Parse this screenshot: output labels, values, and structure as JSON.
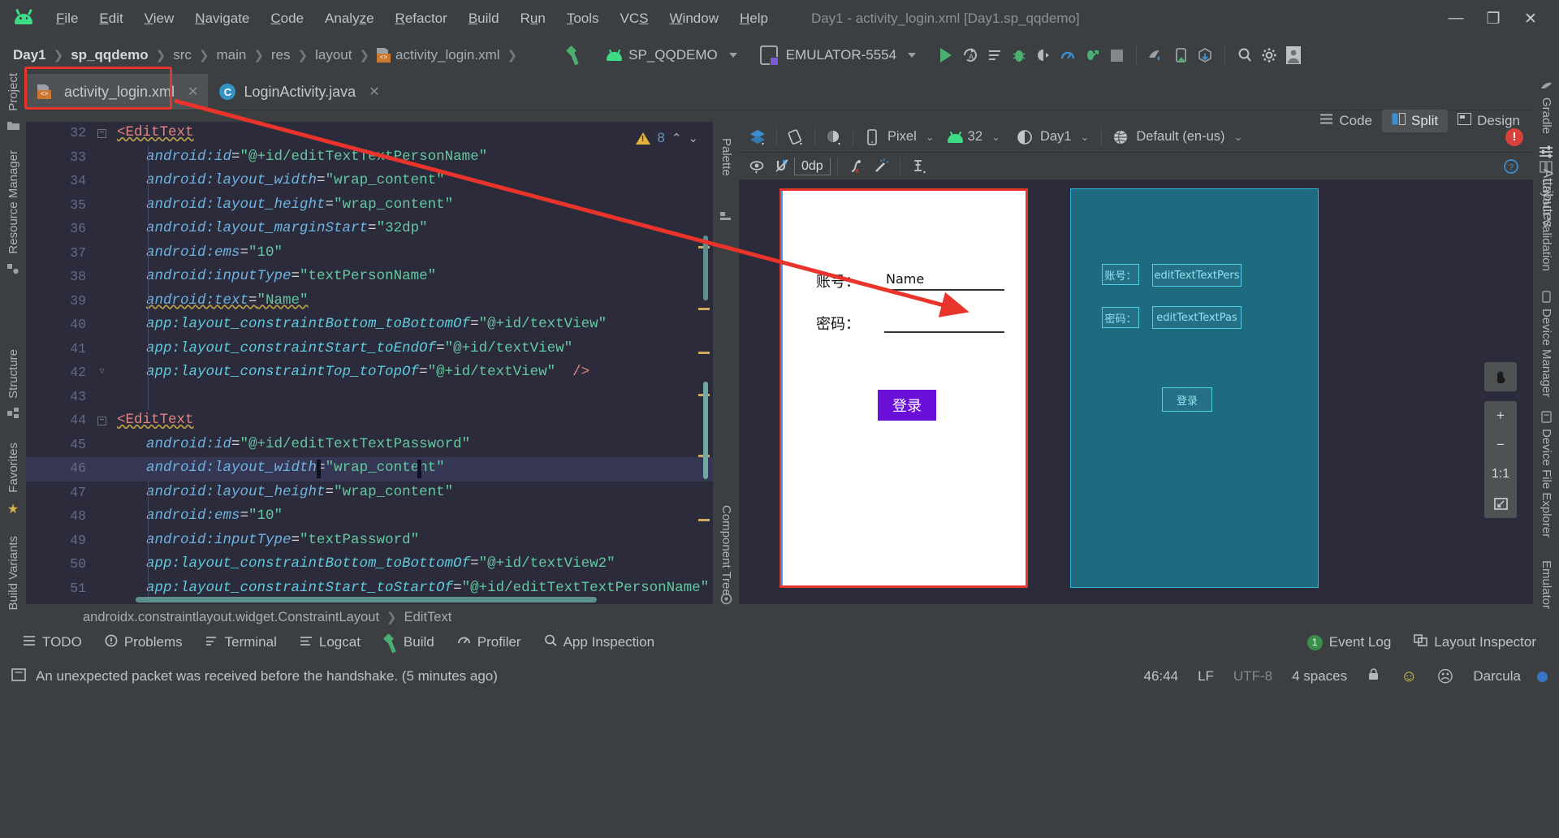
{
  "window": {
    "title": "Day1 - activity_login.xml [Day1.sp_qqdemo]",
    "minimize": "—",
    "maximize": "❐",
    "close": "✕",
    "logo_name": "android-studio-logo"
  },
  "menu": [
    {
      "label": "File",
      "mnemonic": "F"
    },
    {
      "label": "Edit",
      "mnemonic": "E"
    },
    {
      "label": "View",
      "mnemonic": "V"
    },
    {
      "label": "Navigate",
      "mnemonic": "N"
    },
    {
      "label": "Code",
      "mnemonic": "C"
    },
    {
      "label": "Analyze",
      "mnemonic": "z"
    },
    {
      "label": "Refactor",
      "mnemonic": "R"
    },
    {
      "label": "Build",
      "mnemonic": "B"
    },
    {
      "label": "Run",
      "mnemonic": "u"
    },
    {
      "label": "Tools",
      "mnemonic": "T"
    },
    {
      "label": "VCS",
      "mnemonic": ""
    },
    {
      "label": "Window",
      "mnemonic": "W"
    },
    {
      "label": "Help",
      "mnemonic": "H"
    }
  ],
  "breadcrumb": {
    "items": [
      "Day1",
      "sp_qqdemo",
      "src",
      "main",
      "res",
      "layout",
      "activity_login.xml"
    ],
    "separator": "❯"
  },
  "toolbar": {
    "build_label": "build-hammer-icon",
    "module": "SP_QQDEMO",
    "device": "EMULATOR-5554",
    "run_tooltip": "Run",
    "icons": [
      "run-icon",
      "apply-changes-icon",
      "apply-code-changes-icon",
      "debug-icon",
      "attach-debugger-icon",
      "profiler-icon",
      "run-with-coverage-icon",
      "stop-icon",
      "sdk-manager-icon",
      "avd-manager-icon",
      "sync-gradle-icon",
      "search-icon",
      "settings-gear-icon",
      "avatar-icon"
    ]
  },
  "editor_tabs": [
    {
      "label": "activity_login.xml",
      "icon": "xml-layout-icon",
      "active": true,
      "close": "✕",
      "highlighted": true
    },
    {
      "label": "LoginActivity.java",
      "icon": "java-class-icon",
      "active": false,
      "close": "✕",
      "highlighted": false
    }
  ],
  "view_modes": [
    {
      "label": "Code",
      "selected": false,
      "icon": "code-view-icon"
    },
    {
      "label": "Split",
      "selected": true,
      "icon": "split-view-icon"
    },
    {
      "label": "Design",
      "selected": false,
      "icon": "design-view-icon"
    }
  ],
  "left_rail": [
    {
      "label": "Project",
      "icon": "project-icon"
    },
    {
      "label": "Resource Manager",
      "icon": "resource-manager-icon"
    },
    {
      "label": "Structure",
      "icon": "structure-icon"
    },
    {
      "label": "Favorites",
      "icon": "star-icon"
    },
    {
      "label": "Build Variants",
      "icon": "build-variants-icon"
    }
  ],
  "right_rail": [
    {
      "label": "Gradle",
      "icon": "gradle-icon"
    },
    {
      "label": "Layout Validation",
      "icon": "layout-validation-icon"
    },
    {
      "label": "Device Manager",
      "icon": "device-manager-icon"
    },
    {
      "label": "Device File Explorer",
      "icon": "device-file-explorer-icon"
    },
    {
      "label": "Emulator",
      "icon": "emulator-icon"
    }
  ],
  "code": {
    "warning_count": "8",
    "current_line": 46,
    "breadcrumb": [
      "androidx.constraintlayout.widget.ConstraintLayout",
      "EditText"
    ],
    "lines": [
      {
        "n": "32",
        "indent": 0,
        "fold": true,
        "parts": [
          {
            "t": "tag",
            "s": "<EditText",
            "squiggle": true
          }
        ]
      },
      {
        "n": "33",
        "indent": 1,
        "parts": [
          {
            "t": "attr",
            "s": "android:id"
          },
          {
            "t": "eq",
            "s": "="
          },
          {
            "t": "val",
            "s": "\"@+id/editTextTextPersonName\""
          }
        ]
      },
      {
        "n": "34",
        "indent": 1,
        "parts": [
          {
            "t": "attr",
            "s": "android:layout_width"
          },
          {
            "t": "eq",
            "s": "="
          },
          {
            "t": "val",
            "s": "\"wrap_content\""
          }
        ]
      },
      {
        "n": "35",
        "indent": 1,
        "parts": [
          {
            "t": "attr",
            "s": "android:layout_height"
          },
          {
            "t": "eq",
            "s": "="
          },
          {
            "t": "val",
            "s": "\"wrap_content\""
          }
        ]
      },
      {
        "n": "36",
        "indent": 1,
        "parts": [
          {
            "t": "attr",
            "s": "android:layout_marginStart"
          },
          {
            "t": "eq",
            "s": "="
          },
          {
            "t": "val",
            "s": "\"32dp\""
          }
        ]
      },
      {
        "n": "37",
        "indent": 1,
        "parts": [
          {
            "t": "attr",
            "s": "android:ems"
          },
          {
            "t": "eq",
            "s": "="
          },
          {
            "t": "val",
            "s": "\"10\""
          }
        ]
      },
      {
        "n": "38",
        "indent": 1,
        "parts": [
          {
            "t": "attr",
            "s": "android:inputType"
          },
          {
            "t": "eq",
            "s": "="
          },
          {
            "t": "val",
            "s": "\"textPersonName\""
          }
        ]
      },
      {
        "n": "39",
        "indent": 1,
        "squiggle": true,
        "parts": [
          {
            "t": "attr",
            "s": "android:text"
          },
          {
            "t": "eq",
            "s": "="
          },
          {
            "t": "val",
            "s": "\"Name\""
          }
        ]
      },
      {
        "n": "40",
        "indent": 1,
        "parts": [
          {
            "t": "app",
            "s": "app:layout_constraintBottom_toBottomOf"
          },
          {
            "t": "eq",
            "s": "="
          },
          {
            "t": "val",
            "s": "\"@+id/textView\""
          }
        ]
      },
      {
        "n": "41",
        "indent": 1,
        "parts": [
          {
            "t": "app",
            "s": "app:layout_constraintStart_toEndOf"
          },
          {
            "t": "eq",
            "s": "="
          },
          {
            "t": "val",
            "s": "\"@+id/textView\""
          }
        ]
      },
      {
        "n": "42",
        "indent": 1,
        "foldend": true,
        "parts": [
          {
            "t": "app",
            "s": "app:layout_constraintTop_toTopOf"
          },
          {
            "t": "eq",
            "s": "="
          },
          {
            "t": "val",
            "s": "\"@+id/textView\""
          },
          {
            "t": "eq",
            "s": "  "
          },
          {
            "t": "tag",
            "s": "/>"
          }
        ]
      },
      {
        "n": "43",
        "indent": 0,
        "parts": []
      },
      {
        "n": "44",
        "indent": 0,
        "fold": true,
        "parts": [
          {
            "t": "tag",
            "s": "<EditText",
            "squiggle": true
          }
        ]
      },
      {
        "n": "45",
        "indent": 1,
        "parts": [
          {
            "t": "attr",
            "s": "android:id"
          },
          {
            "t": "eq",
            "s": "="
          },
          {
            "t": "val",
            "s": "\"@+id/editTextTextPassword\""
          }
        ]
      },
      {
        "n": "46",
        "indent": 1,
        "current": true,
        "parts": [
          {
            "t": "attr",
            "s": "android:layout_width"
          },
          {
            "t": "eq",
            "s": "="
          },
          {
            "t": "val",
            "s": "\"wrap_content\""
          }
        ]
      },
      {
        "n": "47",
        "indent": 1,
        "parts": [
          {
            "t": "attr",
            "s": "android:layout_height"
          },
          {
            "t": "eq",
            "s": "="
          },
          {
            "t": "val",
            "s": "\"wrap_content\""
          }
        ]
      },
      {
        "n": "48",
        "indent": 1,
        "parts": [
          {
            "t": "attr",
            "s": "android:ems"
          },
          {
            "t": "eq",
            "s": "="
          },
          {
            "t": "val",
            "s": "\"10\""
          }
        ]
      },
      {
        "n": "49",
        "indent": 1,
        "parts": [
          {
            "t": "attr",
            "s": "android:inputType"
          },
          {
            "t": "eq",
            "s": "="
          },
          {
            "t": "val",
            "s": "\"textPassword\""
          }
        ]
      },
      {
        "n": "50",
        "indent": 1,
        "parts": [
          {
            "t": "app",
            "s": "app:layout_constraintBottom_toBottomOf"
          },
          {
            "t": "eq",
            "s": "="
          },
          {
            "t": "val",
            "s": "\"@+id/textView2\""
          }
        ]
      },
      {
        "n": "51",
        "indent": 1,
        "parts": [
          {
            "t": "app",
            "s": "app:layout_constraintStart_toStartOf"
          },
          {
            "t": "eq",
            "s": "="
          },
          {
            "t": "val",
            "s": "\"@+id/editTextTextPersonName\""
          }
        ]
      }
    ]
  },
  "design": {
    "palette_label": "Palette",
    "component_tree_label": "Component Tree",
    "attributes_label": "Attributes",
    "toolbar_row1": {
      "design_surface_icon": "design-surface-icon",
      "orientation_icon": "orientation-icon",
      "theme_mode_icon": "night-mode-icon",
      "device": "Pixel",
      "api_level": "32",
      "theme": "Day1",
      "locale": "Default (en-us)",
      "error_badge": "!"
    },
    "toolbar_row2": {
      "visibility_icon": "eye-icon",
      "magnet_icon": "autoconnect-icon",
      "margin_value": "0dp",
      "clear_constraints_icon": "clear-constraints-icon",
      "infer_constraints_icon": "infer-constraints-icon",
      "guidelines_icon": "guidelines-icon",
      "help_icon": "help-icon"
    },
    "canvas_controls": [
      "pan-icon",
      "zoom-in-icon",
      "zoom-out-icon",
      "zoom-actual-icon",
      "zoom-fit-icon"
    ],
    "zoom_actual_label": "1:1",
    "zoom_in_label": "+",
    "zoom_out_label": "−",
    "preview": {
      "account_label": "账号：",
      "account_value": "Name",
      "password_label": "密码：",
      "password_value": "",
      "login_button": "登录"
    },
    "blueprint": {
      "account_label": "账号：",
      "account_field": "editTextTextPers",
      "password_label": "密码：",
      "password_field": "editTextTextPas",
      "login_button": "登录"
    }
  },
  "bottom_bar": {
    "left": [
      {
        "label": "TODO",
        "icon": "todo-icon"
      },
      {
        "label": "Problems",
        "icon": "problems-icon"
      },
      {
        "label": "Terminal",
        "icon": "terminal-icon"
      },
      {
        "label": "Logcat",
        "icon": "logcat-icon"
      },
      {
        "label": "Build",
        "icon": "build-icon"
      },
      {
        "label": "Profiler",
        "icon": "profiler-icon"
      },
      {
        "label": "App Inspection",
        "icon": "app-inspection-icon"
      }
    ],
    "right": [
      {
        "label": "Event Log",
        "icon": "event-log-icon",
        "badge": "1"
      },
      {
        "label": "Layout Inspector",
        "icon": "layout-inspector-icon",
        "badge": ""
      }
    ]
  },
  "status_bar": {
    "message": "An unexpected packet was received before the handshake. (5 minutes ago)",
    "message_icon": "info-icon",
    "caret": "46:44",
    "line_ending": "LF",
    "encoding": "UTF-8",
    "indent": "4 spaces",
    "lock_icon": "lock-icon",
    "happy_icon": "☺",
    "sad_icon": "☹",
    "theme": "Darcula"
  },
  "colors": {
    "ide_bg": "#3c3f41",
    "editor_bg": "#2b2b3b",
    "accent_green": "#3ddc84",
    "annotation_red": "#e8342a",
    "selection_blue": "#3592c4",
    "button_purple": "#6a10d8",
    "blueprint_teal": "#1e6b80"
  }
}
